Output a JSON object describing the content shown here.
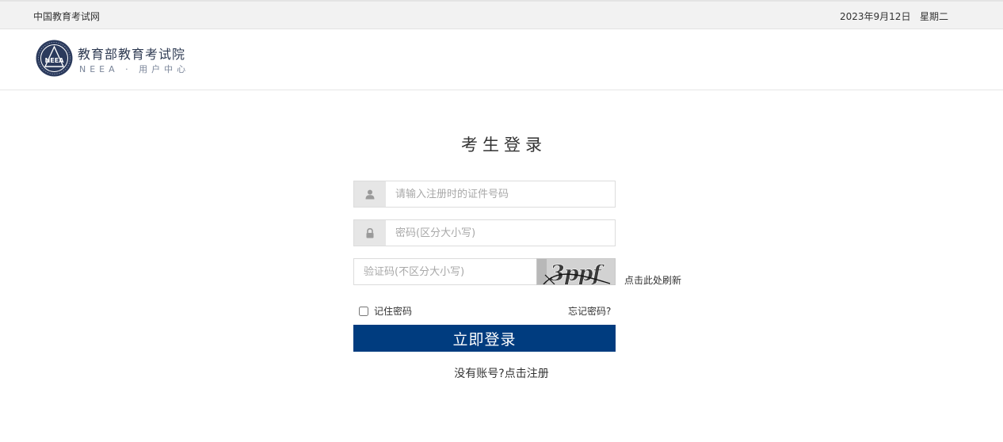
{
  "topbar": {
    "site_name": "中国教育考试网",
    "date": "2023年9月12日",
    "weekday": "星期二"
  },
  "header": {
    "logo_text": "NEEA",
    "org_name": "教育部教育考试院",
    "org_sub": "NEEA · 用户中心"
  },
  "login": {
    "title": "考生登录",
    "id_placeholder": "请输入注册时的证件号码",
    "password_placeholder": "密码(区分大小写)",
    "captcha_placeholder": "验证码(不区分大小写)",
    "captcha_text": "3ppf",
    "refresh_label": "点击此处刷新",
    "remember_label": "记住密码",
    "forgot_label": "忘记密码?",
    "submit_label": "立即登录",
    "register_prompt": "没有账号?",
    "register_link": "点击注册"
  },
  "icons": {
    "user": "user-icon",
    "lock": "lock-icon"
  },
  "colors": {
    "primary": "#003c7f",
    "topbar_bg": "#f2f2f2",
    "addon_bg": "#e6e6e6",
    "placeholder": "#a8a8a8"
  }
}
